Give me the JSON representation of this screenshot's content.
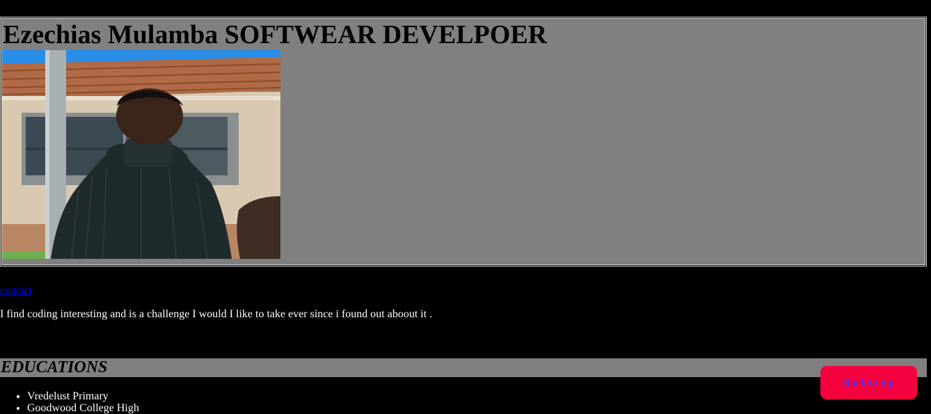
{
  "header": {
    "title": "Ezechias Mulamba SOFTWEAR DEVELPOER"
  },
  "nav": {
    "contact_label": "contact"
  },
  "about": {
    "text": "I find coding interesting and is a challenge I would I like to take ever since i found out aboout it ."
  },
  "education": {
    "heading": "EDUCATIONS",
    "items": [
      "Vredelust Primary",
      "Goodwood College High"
    ]
  },
  "back_to_top": {
    "label": "Back to top"
  },
  "colors": {
    "page_background": "#000000",
    "panel_gray": "#808080",
    "back_to_top_bg": "#f5003f",
    "back_to_top_text": "#5a2bdc",
    "link": "#0000ee"
  }
}
